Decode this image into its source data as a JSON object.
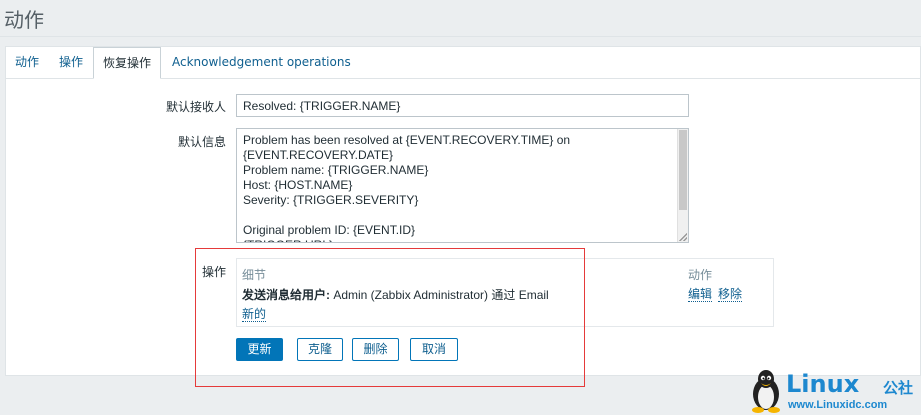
{
  "page": {
    "title": "动作"
  },
  "tabs": [
    {
      "label": "动作",
      "active": false
    },
    {
      "label": "操作",
      "active": false
    },
    {
      "label": "恢复操作",
      "active": true
    },
    {
      "label": "Acknowledgement operations",
      "active": false
    }
  ],
  "form": {
    "recipient_label": "默认接收人",
    "recipient_value": "Resolved: {TRIGGER.NAME}",
    "message_label": "默认信息",
    "message_value": "Problem has been resolved at {EVENT.RECOVERY.TIME} on\n{EVENT.RECOVERY.DATE}\nProblem name: {TRIGGER.NAME}\nHost: {HOST.NAME}\nSeverity: {TRIGGER.SEVERITY}\n\nOriginal problem ID: {EVENT.ID}\n{TRIGGER.URL}",
    "operations_label": "操作"
  },
  "operations": {
    "col_details": "细节",
    "col_action": "动作",
    "rows": [
      {
        "prefix": "发送消息给用户:",
        "text": " Admin (Zabbix Administrator) 通过 Email",
        "edit": "编辑",
        "remove": "移除"
      }
    ],
    "new_link": "新的"
  },
  "buttons": {
    "update": "更新",
    "clone": "克隆",
    "delete": "删除",
    "cancel": "取消"
  },
  "watermark": {
    "brand": "Linux",
    "brand_suffix": "公社",
    "url": "www.Linuxidc.com"
  },
  "colors": {
    "link": "#0f5f8f",
    "primary": "#0275b8",
    "annotation": "#e53a3a"
  }
}
